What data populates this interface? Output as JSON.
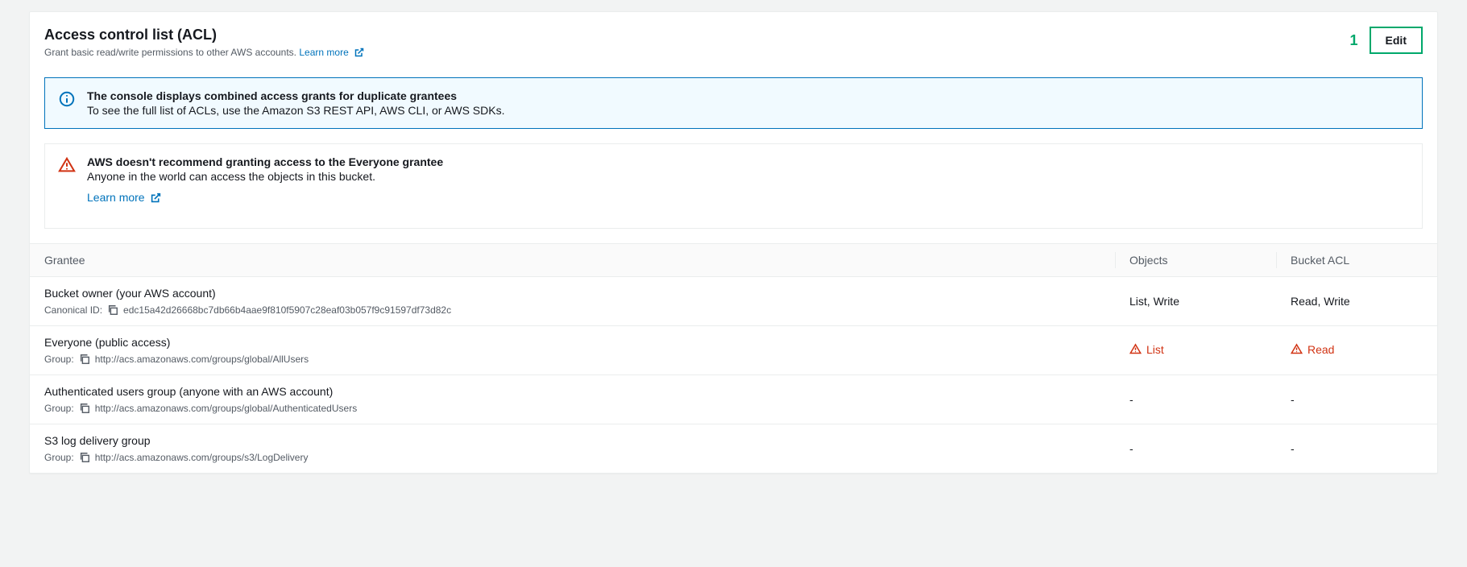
{
  "header": {
    "title": "Access control list (ACL)",
    "description": "Grant basic read/write permissions to other AWS accounts.",
    "learn_more": "Learn more",
    "step_number": "1",
    "edit_label": "Edit"
  },
  "info_alert": {
    "title": "The console displays combined access grants for duplicate grantees",
    "body": "To see the full list of ACLs, use the Amazon S3 REST API, AWS CLI, or AWS SDKs."
  },
  "warn_alert": {
    "title": "AWS doesn't recommend granting access to the Everyone grantee",
    "body": "Anyone in the world can access the objects in this bucket.",
    "learn_more": "Learn more"
  },
  "table": {
    "headers": {
      "grantee": "Grantee",
      "objects": "Objects",
      "bucket_acl": "Bucket ACL"
    },
    "rows": [
      {
        "name": "Bucket owner (your AWS account)",
        "sub_label": "Canonical ID:",
        "sub_value": "edc15a42d26668bc7db66b4aae9f810f5907c28eaf03b057f9c91597df73d82c",
        "objects": "List, Write",
        "objects_danger": false,
        "bucket_acl": "Read, Write",
        "bucket_acl_danger": false
      },
      {
        "name": "Everyone (public access)",
        "sub_label": "Group:",
        "sub_value": "http://acs.amazonaws.com/groups/global/AllUsers",
        "objects": "List",
        "objects_danger": true,
        "bucket_acl": "Read",
        "bucket_acl_danger": true
      },
      {
        "name": "Authenticated users group (anyone with an AWS account)",
        "sub_label": "Group:",
        "sub_value": "http://acs.amazonaws.com/groups/global/AuthenticatedUsers",
        "objects": "-",
        "objects_danger": false,
        "bucket_acl": "-",
        "bucket_acl_danger": false
      },
      {
        "name": "S3 log delivery group",
        "sub_label": "Group:",
        "sub_value": "http://acs.amazonaws.com/groups/s3/LogDelivery",
        "objects": "-",
        "objects_danger": false,
        "bucket_acl": "-",
        "bucket_acl_danger": false
      }
    ]
  }
}
